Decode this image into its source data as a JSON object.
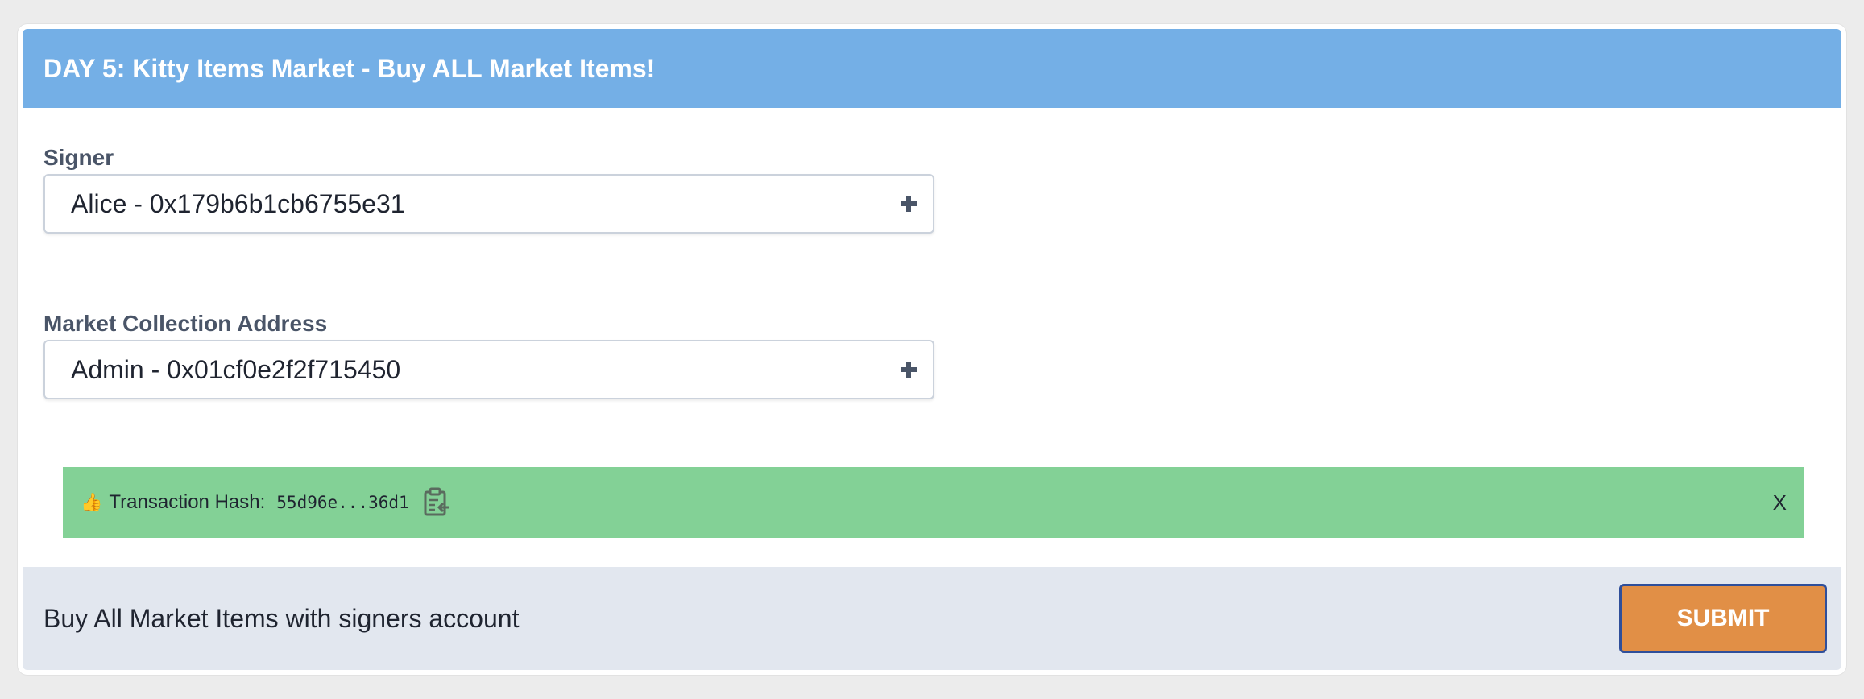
{
  "header": {
    "title": "DAY 5: Kitty Items Market - Buy ALL Market Items!"
  },
  "signer": {
    "label": "Signer",
    "value": "Alice - 0x179b6b1cb6755e31"
  },
  "market": {
    "label": "Market Collection Address",
    "value": "Admin - 0x01cf0e2f2f715450"
  },
  "alert": {
    "emoji": "👍",
    "label": "Transaction Hash:",
    "hash": "55d96e...36d1",
    "close": "X"
  },
  "footer": {
    "description": "Buy All Market Items with signers account",
    "submit_label": "SUBMIT"
  },
  "colors": {
    "header_bg": "#74afe6",
    "alert_bg": "#83d196",
    "footer_bg": "#e2e7ef",
    "submit_bg": "#e18f46",
    "submit_border": "#2f4f9a"
  },
  "icons": [
    "thumbs-up-icon",
    "clipboard-icon",
    "plus-icon",
    "close-icon"
  ]
}
